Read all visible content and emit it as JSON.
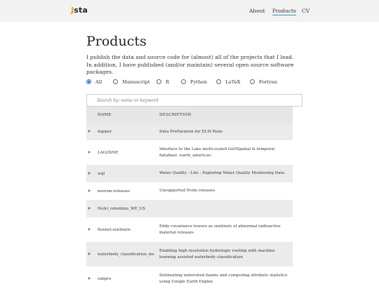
{
  "header": {
    "logo_mark": "J",
    "logo_text": "sta",
    "nav": [
      {
        "label": "About"
      },
      {
        "label": "Products",
        "active": true
      },
      {
        "label": "CV"
      }
    ],
    "accent_color": "#3b8fb8"
  },
  "main": {
    "title": "Products",
    "intro": "I publish the data and source code for (almost) all of the projects that I lead. In addition, I have published (and/or maintain) several open source software packages.",
    "filters": [
      {
        "label": "All",
        "selected": true
      },
      {
        "label": "Manuscript",
        "selected": false
      },
      {
        "label": "R",
        "selected": false
      },
      {
        "label": "Python",
        "selected": false
      },
      {
        "label": "LaTeX",
        "selected": false
      },
      {
        "label": "Fortran",
        "selected": false
      }
    ],
    "search": {
      "placeholder": "Search by: name or keyword"
    },
    "table": {
      "columns": [
        "NAME",
        "DESCRIPTION"
      ],
      "rows": [
        {
          "name": "dapper",
          "description": "Data PreParation for ELM Runs"
        },
        {
          "name": "LAGOSNE",
          "description": "Interface to the Lake multi-scaled GeOSpatial & temporal database :earth_americas:"
        },
        {
          "name": "wql",
          "description": "Water Quality - Lite : Exploring Water Quality Monitoring Data"
        },
        {
          "name": "neovim-releases",
          "description": "Unsupported Nvim releases"
        },
        {
          "name": "Nutri_retention_WE_US",
          "description": ""
        },
        {
          "name": "fluxnet-sentinels",
          "description": "Eddy covariance towers as sentinels of abnormal radioactive material releases"
        },
        {
          "name": "waterbody_classification_ms",
          "description": "Enabling high resolution hydrologic routing with machine learning assisted waterbody classification"
        },
        {
          "name": "rabpro",
          "description": "Delineating watershed basins and computing attribute statistics using Google Earth Engine"
        }
      ]
    }
  }
}
